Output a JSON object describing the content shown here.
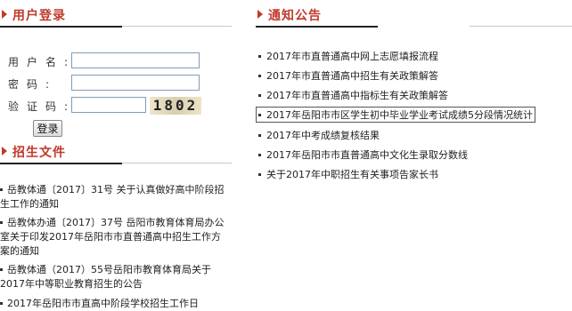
{
  "login": {
    "title": "用户登录",
    "username_label": "用户名:",
    "password_label": "密码:",
    "captcha_label": "验证码:",
    "captcha_text": "1802",
    "submit_label": "登录"
  },
  "notices": {
    "title": "通知公告",
    "items": [
      "2017年市直普通高中网上志愿填报流程",
      "2017年市直普通高中招生有关政策解答",
      "2017年市直普通高中指标生有关政策解答",
      "2017年岳阳市市区学生初中毕业学业考试成绩5分段情况统计",
      "2017年中考成绩复核结果",
      "2017年岳阳市市直普通高中文化生录取分数线",
      "关于2017年中职招生有关事项告家长书"
    ]
  },
  "documents": {
    "title": "招生文件",
    "items": [
      "岳教体通〔2017〕31号 关于认真做好高中阶段招生工作的通知",
      "岳教体办通〔2017〕37号 岳阳市教育体育局办公室关于印发2017年岳阳市市直普通高中招生工作方案的通知",
      "岳教体通（2017）55号岳阳市教育体育局关于2017年中等职业教育招生的公告",
      "2017年岳阳市市直高中阶段学校招生工作日"
    ]
  },
  "colors": {
    "accent": "#c0392b"
  }
}
